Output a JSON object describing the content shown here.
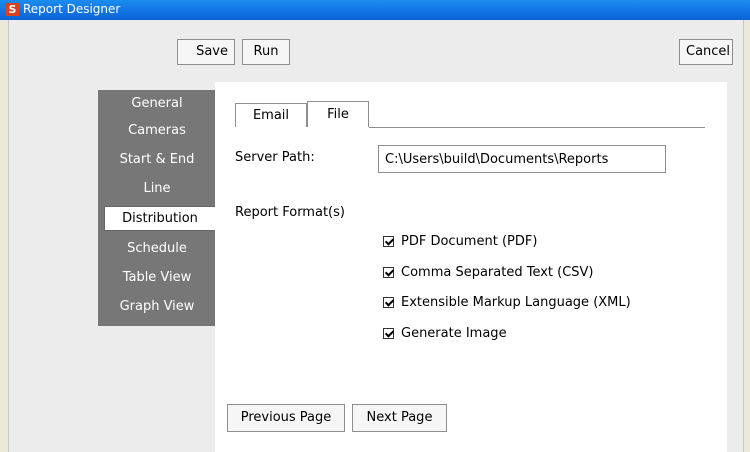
{
  "window": {
    "title": "Report Designer",
    "icon": "app-logo-icon"
  },
  "toolbar": {
    "save": "Save",
    "run": "Run",
    "cancel": "Cancel"
  },
  "sidebar": {
    "items": [
      {
        "label": "General",
        "active": false
      },
      {
        "label": "Cameras",
        "active": false
      },
      {
        "label": "Start & End",
        "active": false
      },
      {
        "label": "Line",
        "active": false
      },
      {
        "label": "Distribution",
        "active": true
      },
      {
        "label": "Schedule",
        "active": false
      },
      {
        "label": "Table View",
        "active": false
      },
      {
        "label": "Graph View",
        "active": false
      }
    ]
  },
  "tabs": [
    {
      "label": "Email",
      "active": false
    },
    {
      "label": "File",
      "active": true
    }
  ],
  "form": {
    "server_path_label": "Server Path:",
    "server_path_value": "C:\\Users\\build\\Documents\\Reports",
    "report_format_label": "Report Format(s)",
    "formats": [
      {
        "label": "PDF Document (PDF)",
        "checked": true
      },
      {
        "label": "Comma Separated Text (CSV)",
        "checked": true
      },
      {
        "label": "Extensible Markup Language (XML)",
        "checked": true
      },
      {
        "label": "Generate Image",
        "checked": true
      }
    ]
  },
  "footer": {
    "previous": "Previous Page",
    "next": "Next Page"
  }
}
